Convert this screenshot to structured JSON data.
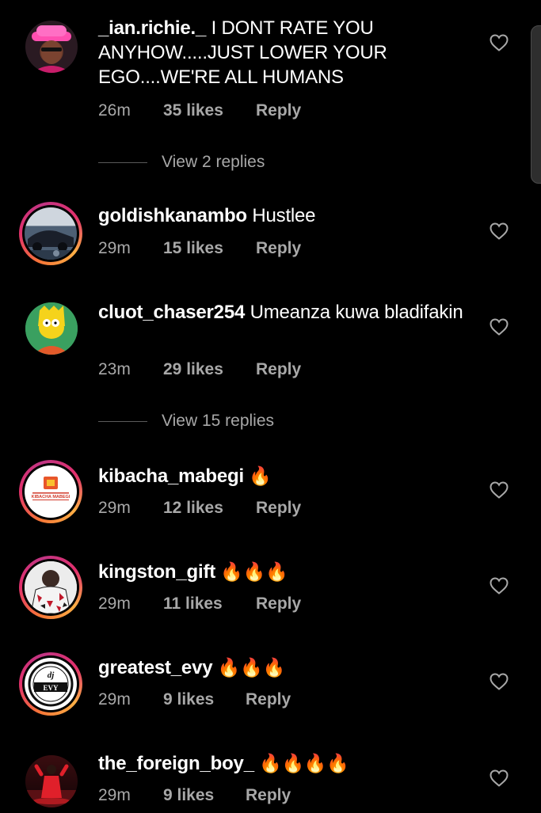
{
  "comments": [
    {
      "username": "_ian.richie._",
      "text": " I DONT RATE YOU ANYHOW.....JUST LOWER YOUR EGO....WE'RE ALL HUMANS",
      "time": "26m",
      "likes": "35 likes",
      "reply": "Reply"
    },
    {
      "username": "goldishkanambo",
      "text": " Hustlee",
      "time": "29m",
      "likes": "15 likes",
      "reply": "Reply"
    },
    {
      "username": "cluot_chaser254",
      "text": " Umeanza kuwa bladifakin",
      "time": "23m",
      "likes": "29 likes",
      "reply": "Reply"
    },
    {
      "username": "kibacha_mabegi",
      "text": " 🔥",
      "time": "29m",
      "likes": "12 likes",
      "reply": "Reply",
      "avatar_text": "KIBACHA MABEGI"
    },
    {
      "username": "kingston_gift",
      "text": " 🔥🔥🔥",
      "time": "29m",
      "likes": "11 likes",
      "reply": "Reply"
    },
    {
      "username": "greatest_evy",
      "text": " 🔥🔥🔥",
      "time": "29m",
      "likes": "9 likes",
      "reply": "Reply",
      "avatar_text": "EVY"
    },
    {
      "username": "the_foreign_boy_",
      "text": " 🔥🔥🔥🔥",
      "time": "29m",
      "likes": "9 likes",
      "reply": "Reply"
    }
  ],
  "view_replies": [
    "View 2 replies",
    "View 15 replies"
  ],
  "colors": {
    "background": "#000000",
    "text": "#ffffff",
    "secondary": "#a8a8a8",
    "story_ring": "#e1306c"
  },
  "icons": {
    "like": "heart-outline-icon"
  }
}
